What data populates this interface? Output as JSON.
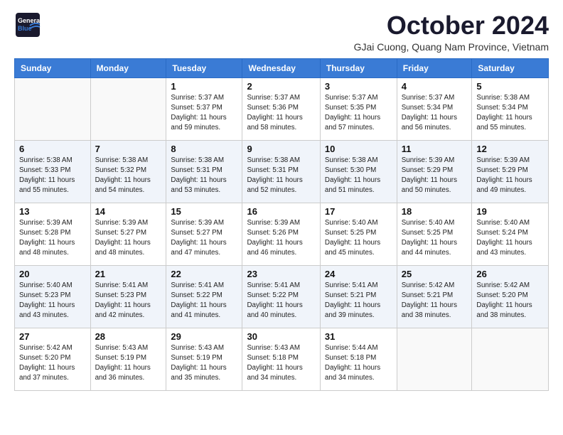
{
  "header": {
    "logo_general": "General",
    "logo_blue": "Blue",
    "month": "October 2024",
    "location": "GJai Cuong, Quang Nam Province, Vietnam"
  },
  "days_of_week": [
    "Sunday",
    "Monday",
    "Tuesday",
    "Wednesday",
    "Thursday",
    "Friday",
    "Saturday"
  ],
  "weeks": [
    [
      {
        "day": "",
        "info": ""
      },
      {
        "day": "",
        "info": ""
      },
      {
        "day": "1",
        "info": "Sunrise: 5:37 AM\nSunset: 5:37 PM\nDaylight: 11 hours and 59 minutes."
      },
      {
        "day": "2",
        "info": "Sunrise: 5:37 AM\nSunset: 5:36 PM\nDaylight: 11 hours and 58 minutes."
      },
      {
        "day": "3",
        "info": "Sunrise: 5:37 AM\nSunset: 5:35 PM\nDaylight: 11 hours and 57 minutes."
      },
      {
        "day": "4",
        "info": "Sunrise: 5:37 AM\nSunset: 5:34 PM\nDaylight: 11 hours and 56 minutes."
      },
      {
        "day": "5",
        "info": "Sunrise: 5:38 AM\nSunset: 5:34 PM\nDaylight: 11 hours and 55 minutes."
      }
    ],
    [
      {
        "day": "6",
        "info": "Sunrise: 5:38 AM\nSunset: 5:33 PM\nDaylight: 11 hours and 55 minutes."
      },
      {
        "day": "7",
        "info": "Sunrise: 5:38 AM\nSunset: 5:32 PM\nDaylight: 11 hours and 54 minutes."
      },
      {
        "day": "8",
        "info": "Sunrise: 5:38 AM\nSunset: 5:31 PM\nDaylight: 11 hours and 53 minutes."
      },
      {
        "day": "9",
        "info": "Sunrise: 5:38 AM\nSunset: 5:31 PM\nDaylight: 11 hours and 52 minutes."
      },
      {
        "day": "10",
        "info": "Sunrise: 5:38 AM\nSunset: 5:30 PM\nDaylight: 11 hours and 51 minutes."
      },
      {
        "day": "11",
        "info": "Sunrise: 5:39 AM\nSunset: 5:29 PM\nDaylight: 11 hours and 50 minutes."
      },
      {
        "day": "12",
        "info": "Sunrise: 5:39 AM\nSunset: 5:29 PM\nDaylight: 11 hours and 49 minutes."
      }
    ],
    [
      {
        "day": "13",
        "info": "Sunrise: 5:39 AM\nSunset: 5:28 PM\nDaylight: 11 hours and 48 minutes."
      },
      {
        "day": "14",
        "info": "Sunrise: 5:39 AM\nSunset: 5:27 PM\nDaylight: 11 hours and 48 minutes."
      },
      {
        "day": "15",
        "info": "Sunrise: 5:39 AM\nSunset: 5:27 PM\nDaylight: 11 hours and 47 minutes."
      },
      {
        "day": "16",
        "info": "Sunrise: 5:39 AM\nSunset: 5:26 PM\nDaylight: 11 hours and 46 minutes."
      },
      {
        "day": "17",
        "info": "Sunrise: 5:40 AM\nSunset: 5:25 PM\nDaylight: 11 hours and 45 minutes."
      },
      {
        "day": "18",
        "info": "Sunrise: 5:40 AM\nSunset: 5:25 PM\nDaylight: 11 hours and 44 minutes."
      },
      {
        "day": "19",
        "info": "Sunrise: 5:40 AM\nSunset: 5:24 PM\nDaylight: 11 hours and 43 minutes."
      }
    ],
    [
      {
        "day": "20",
        "info": "Sunrise: 5:40 AM\nSunset: 5:23 PM\nDaylight: 11 hours and 43 minutes."
      },
      {
        "day": "21",
        "info": "Sunrise: 5:41 AM\nSunset: 5:23 PM\nDaylight: 11 hours and 42 minutes."
      },
      {
        "day": "22",
        "info": "Sunrise: 5:41 AM\nSunset: 5:22 PM\nDaylight: 11 hours and 41 minutes."
      },
      {
        "day": "23",
        "info": "Sunrise: 5:41 AM\nSunset: 5:22 PM\nDaylight: 11 hours and 40 minutes."
      },
      {
        "day": "24",
        "info": "Sunrise: 5:41 AM\nSunset: 5:21 PM\nDaylight: 11 hours and 39 minutes."
      },
      {
        "day": "25",
        "info": "Sunrise: 5:42 AM\nSunset: 5:21 PM\nDaylight: 11 hours and 38 minutes."
      },
      {
        "day": "26",
        "info": "Sunrise: 5:42 AM\nSunset: 5:20 PM\nDaylight: 11 hours and 38 minutes."
      }
    ],
    [
      {
        "day": "27",
        "info": "Sunrise: 5:42 AM\nSunset: 5:20 PM\nDaylight: 11 hours and 37 minutes."
      },
      {
        "day": "28",
        "info": "Sunrise: 5:43 AM\nSunset: 5:19 PM\nDaylight: 11 hours and 36 minutes."
      },
      {
        "day": "29",
        "info": "Sunrise: 5:43 AM\nSunset: 5:19 PM\nDaylight: 11 hours and 35 minutes."
      },
      {
        "day": "30",
        "info": "Sunrise: 5:43 AM\nSunset: 5:18 PM\nDaylight: 11 hours and 34 minutes."
      },
      {
        "day": "31",
        "info": "Sunrise: 5:44 AM\nSunset: 5:18 PM\nDaylight: 11 hours and 34 minutes."
      },
      {
        "day": "",
        "info": ""
      },
      {
        "day": "",
        "info": ""
      }
    ]
  ]
}
